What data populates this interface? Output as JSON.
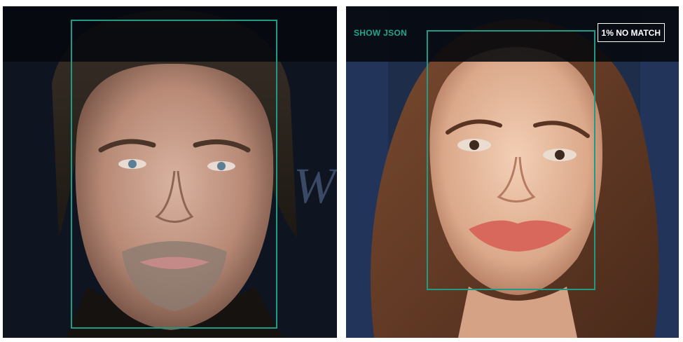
{
  "comparison": {
    "left": {
      "subject": "face-photo-left"
    },
    "right": {
      "show_json_label": "SHOW JSON",
      "match_label": "1% NO MATCH"
    }
  },
  "colors": {
    "face_box": "#1e9a86",
    "show_json_text": "#1fa690",
    "overlay_bar": "#06080c"
  }
}
